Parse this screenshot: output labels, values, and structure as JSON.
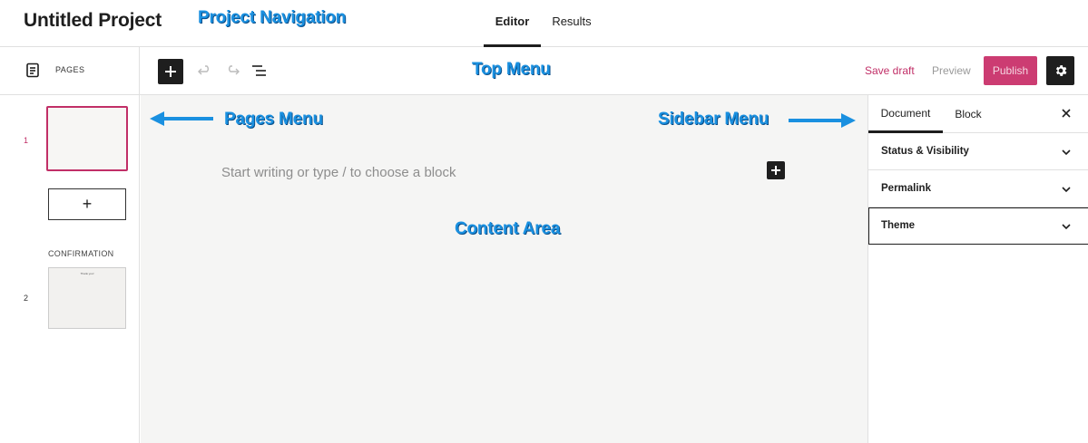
{
  "project_nav": {
    "title": "Untitled Project",
    "tabs": [
      {
        "label": "Editor",
        "active": true
      },
      {
        "label": "Results",
        "active": false
      }
    ]
  },
  "pages_header": {
    "icon": "pages-icon",
    "label": "PAGES"
  },
  "toolbar": {
    "icons": [
      "add-block-icon",
      "undo-icon",
      "redo-icon",
      "list-view-icon",
      "gear-icon"
    ],
    "save_draft": "Save draft",
    "preview": "Preview",
    "publish": "Publish"
  },
  "pages": {
    "items": [
      {
        "number": "1",
        "selected": true,
        "thumb_text": ""
      },
      {
        "number": "2",
        "section": "CONFIRMATION",
        "selected": false,
        "thumb_text": "Thank you!"
      }
    ],
    "add_page_label": "+"
  },
  "content": {
    "placeholder": "Start writing or type / to choose a block"
  },
  "sidebar": {
    "tabs": [
      {
        "label": "Document",
        "active": true
      },
      {
        "label": "Block",
        "active": false
      }
    ],
    "close": "×",
    "panels": [
      {
        "label": "Status & Visibility"
      },
      {
        "label": "Permalink"
      },
      {
        "label": "Theme",
        "focused": true
      }
    ]
  },
  "annotations": {
    "project_navigation": "Project Navigation",
    "top_menu": "Top Menu",
    "pages_menu": "Pages Menu",
    "sidebar_menu": "Sidebar Menu",
    "content_area": "Content Area"
  },
  "colors": {
    "accent": "#c12f67",
    "publish_bg": "#cc3c72",
    "annotation": "#1a90e0",
    "dark": "#1e1e1e",
    "canvas": "#f5f5f4"
  }
}
